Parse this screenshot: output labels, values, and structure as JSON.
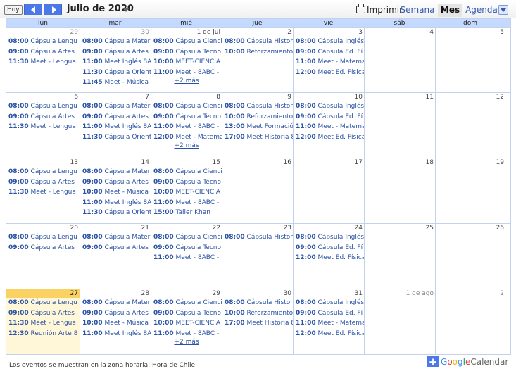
{
  "toolbar": {
    "today_label": "Hoy",
    "prev_icon": "chevron-left-icon",
    "next_icon": "chevron-right-icon",
    "month_title": "julio de 2020",
    "print_label": "Imprimir",
    "views": [
      "Semana",
      "Mes",
      "Agenda"
    ],
    "active_view": "Mes"
  },
  "weekdays": [
    "lun",
    "mar",
    "mié",
    "jue",
    "vie",
    "sáb",
    "dom"
  ],
  "weeks": [
    {
      "days": [
        {
          "num": "29",
          "other": true,
          "events": [
            {
              "time": "08:00",
              "title": "Cápsula Lengu"
            },
            {
              "time": "09:00",
              "title": "Cápsula Artes"
            },
            {
              "time": "11:30",
              "title": "Meet - Lengua"
            }
          ]
        },
        {
          "num": "30",
          "other": true,
          "events": [
            {
              "time": "08:00",
              "title": "Cápsula Mater"
            },
            {
              "time": "09:00",
              "title": "Cápsula Artes"
            },
            {
              "time": "11:00",
              "title": "Meet Inglés 8A"
            },
            {
              "time": "11:30",
              "title": "Cápsula Orient"
            },
            {
              "time": "11:45",
              "title": "Meet - Música"
            }
          ]
        },
        {
          "num": "1 de jul",
          "events": [
            {
              "time": "08:00",
              "title": "Cápsula Cienci"
            },
            {
              "time": "09:00",
              "title": "Cápsula Tecno"
            },
            {
              "time": "10:00",
              "title": "MEET-CIENCIA"
            },
            {
              "time": "11:00",
              "title": "Meet - 8ABC -"
            }
          ],
          "more": "+2 más"
        },
        {
          "num": "2",
          "events": [
            {
              "time": "08:00",
              "title": "Cápsula Histor"
            },
            {
              "time": "10:00",
              "title": "Reforzamiento"
            }
          ]
        },
        {
          "num": "3",
          "events": [
            {
              "time": "08:00",
              "title": "Cápsula Inglés"
            },
            {
              "time": "09:00",
              "title": "Cápsula Ed. Fí"
            },
            {
              "time": "11:00",
              "title": "Meet - Matema"
            },
            {
              "time": "12:00",
              "title": "Meet Ed. Física"
            }
          ]
        },
        {
          "num": "4",
          "events": []
        },
        {
          "num": "5",
          "events": []
        }
      ]
    },
    {
      "days": [
        {
          "num": "6",
          "events": [
            {
              "time": "08:00",
              "title": "Cápsula Lengu"
            },
            {
              "time": "09:00",
              "title": "Cápsula Artes"
            },
            {
              "time": "11:30",
              "title": "Meet - Lengua"
            }
          ]
        },
        {
          "num": "7",
          "events": [
            {
              "time": "08:00",
              "title": "Cápsula Mater"
            },
            {
              "time": "09:00",
              "title": "Cápsula Artes"
            },
            {
              "time": "11:00",
              "title": "Meet Inglés 8A"
            },
            {
              "time": "11:30",
              "title": "Cápsula Orient"
            }
          ]
        },
        {
          "num": "8",
          "events": [
            {
              "time": "08:00",
              "title": "Cápsula Cienci"
            },
            {
              "time": "09:00",
              "title": "Cápsula Tecno"
            },
            {
              "time": "11:00",
              "title": "Meet - 8ABC -"
            },
            {
              "time": "12:00",
              "title": "Meet - Matema"
            }
          ],
          "more": "+2 más"
        },
        {
          "num": "9",
          "events": [
            {
              "time": "08:00",
              "title": "Cápsula Histor"
            },
            {
              "time": "10:00",
              "title": "Reforzamiento"
            },
            {
              "time": "13:00",
              "title": "Meet Formació"
            },
            {
              "time": "17:00",
              "title": "Meet Historia 8"
            }
          ]
        },
        {
          "num": "10",
          "events": [
            {
              "time": "08:00",
              "title": "Cápsula Inglés"
            },
            {
              "time": "09:00",
              "title": "Cápsula Ed. Fí"
            },
            {
              "time": "11:00",
              "title": "Meet - Matema"
            },
            {
              "time": "12:00",
              "title": "Meet Ed. Física"
            }
          ]
        },
        {
          "num": "11",
          "events": []
        },
        {
          "num": "12",
          "events": []
        }
      ]
    },
    {
      "days": [
        {
          "num": "13",
          "events": [
            {
              "time": "08:00",
              "title": "Cápsula Lengu"
            },
            {
              "time": "09:00",
              "title": "Cápsula Artes"
            },
            {
              "time": "11:30",
              "title": "Meet - Lengua"
            }
          ]
        },
        {
          "num": "14",
          "events": [
            {
              "time": "08:00",
              "title": "Cápsula Mater"
            },
            {
              "time": "09:00",
              "title": "Cápsula Artes"
            },
            {
              "time": "10:00",
              "title": "Meet - Música"
            },
            {
              "time": "11:00",
              "title": "Meet Inglés 8A"
            },
            {
              "time": "11:30",
              "title": "Cápsula Orient"
            }
          ]
        },
        {
          "num": "15",
          "events": [
            {
              "time": "08:00",
              "title": "Cápsula Cienci"
            },
            {
              "time": "09:00",
              "title": "Cápsula Tecno"
            },
            {
              "time": "10:00",
              "title": "MEET-CIENCIA"
            },
            {
              "time": "11:00",
              "title": "Meet - 8ABC -"
            },
            {
              "time": "15:00",
              "title": "Taller Khan"
            }
          ]
        },
        {
          "num": "16",
          "events": []
        },
        {
          "num": "17",
          "events": []
        },
        {
          "num": "18",
          "events": []
        },
        {
          "num": "19",
          "events": []
        }
      ]
    },
    {
      "days": [
        {
          "num": "20",
          "events": [
            {
              "time": "08:00",
              "title": "Cápsula Lengu"
            },
            {
              "time": "09:00",
              "title": "Cápsula Artes"
            }
          ]
        },
        {
          "num": "21",
          "events": [
            {
              "time": "08:00",
              "title": "Cápsula Mater"
            },
            {
              "time": "09:00",
              "title": "Cápsula Artes"
            }
          ]
        },
        {
          "num": "22",
          "events": [
            {
              "time": "08:00",
              "title": "Cápsula Cienci"
            },
            {
              "time": "09:00",
              "title": "Cápsula Tecno"
            },
            {
              "time": "11:00",
              "title": "Meet - 8ABC -"
            }
          ]
        },
        {
          "num": "23",
          "events": [
            {
              "time": "08:00",
              "title": "Cápsula Histor"
            }
          ]
        },
        {
          "num": "24",
          "events": [
            {
              "time": "08:00",
              "title": "Cápsula Inglés"
            },
            {
              "time": "09:00",
              "title": "Cápsula Ed. Fí"
            },
            {
              "time": "12:00",
              "title": "Meet Ed. Física"
            }
          ]
        },
        {
          "num": "25",
          "events": []
        },
        {
          "num": "26",
          "events": []
        }
      ]
    },
    {
      "days": [
        {
          "num": "27",
          "today": true,
          "events": [
            {
              "time": "08:00",
              "title": "Cápsula Lengu"
            },
            {
              "time": "09:00",
              "title": "Cápsula Artes"
            },
            {
              "time": "11:30",
              "title": "Meet - Lengua"
            },
            {
              "time": "12:30",
              "title": "Reunión Arte 8"
            }
          ]
        },
        {
          "num": "28",
          "events": [
            {
              "time": "08:00",
              "title": "Cápsula Mater"
            },
            {
              "time": "09:00",
              "title": "Cápsula Artes"
            },
            {
              "time": "10:00",
              "title": "Meet - Música"
            },
            {
              "time": "11:00",
              "title": "Meet Inglés 8A"
            }
          ]
        },
        {
          "num": "29",
          "events": [
            {
              "time": "08:00",
              "title": "Cápsula Cienci"
            },
            {
              "time": "09:00",
              "title": "Cápsula Tecno"
            },
            {
              "time": "10:00",
              "title": "MEET-CIENCIA"
            },
            {
              "time": "11:00",
              "title": "Meet - 8ABC -"
            }
          ],
          "more": "+2 más"
        },
        {
          "num": "30",
          "events": [
            {
              "time": "08:00",
              "title": "Cápsula Histor"
            },
            {
              "time": "10:00",
              "title": "Reforzamiento"
            },
            {
              "time": "17:00",
              "title": "Meet Historia 8"
            }
          ]
        },
        {
          "num": "31",
          "events": [
            {
              "time": "08:00",
              "title": "Cápsula Inglés"
            },
            {
              "time": "09:00",
              "title": "Cápsula Ed. Fí"
            },
            {
              "time": "11:00",
              "title": "Meet - Matema"
            },
            {
              "time": "12:00",
              "title": "Meet Ed. Física"
            }
          ]
        },
        {
          "num": "1 de ago",
          "other": true,
          "events": []
        },
        {
          "num": "2",
          "other": true,
          "events": []
        }
      ]
    }
  ],
  "footer": {
    "timezone_note": "Los eventos se muestran en la zona horaria: Hora de Chile"
  },
  "branding": {
    "plus_icon": "plus-icon",
    "google_letters": [
      "G",
      "o",
      "o",
      "g",
      "l",
      "e"
    ],
    "calendar_word": "Calendar"
  },
  "colors": {
    "accent": "#4d79e8",
    "header_bg": "#c3d9ff",
    "today_bg": "#fad163",
    "event_text": "#2952a3"
  }
}
